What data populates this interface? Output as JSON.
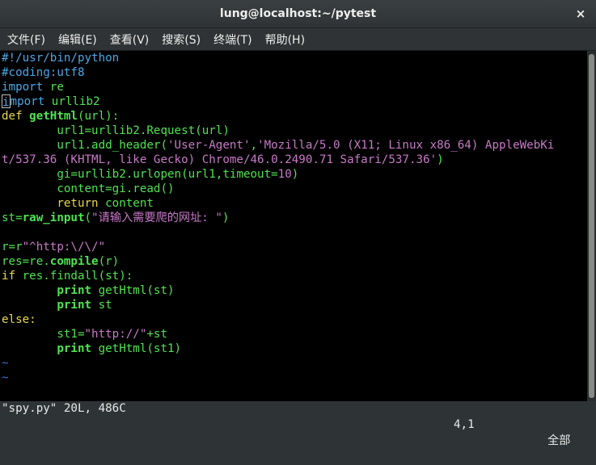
{
  "window": {
    "title": "lung@localhost:~/pytest",
    "close_glyph": "×"
  },
  "menu": [
    "文件(F)",
    "编辑(E)",
    "查看(V)",
    "搜索(S)",
    "终端(T)",
    "帮助(H)"
  ],
  "code": {
    "l1": "#!/usr/bin/python",
    "l2": "#coding:utf8",
    "l3a": "import",
    "l3b": " re",
    "l4_cursor": "i",
    "l4a": "mport",
    "l4b": " urllib2",
    "l5a": "def ",
    "l5b": "getHtml",
    "l5c": "(url):",
    "l6": "        url1=urllib2.Request(url)",
    "l7a": "        url1.add_header(",
    "l7b": "'User-Agent'",
    "l7c": ",",
    "l7d": "'Mozilla/5.0 (X11; Linux x86_64) AppleWebKi",
    "l8a": "t/537.36 (KHTML, like Gecko) Chrome/46.0.2490.71 Safari/537.36'",
    "l8b": ")",
    "l9a": "        gi=urllib2.urlopen(url1,timeout=",
    "l9b": "10",
    "l9c": ")",
    "l10": "        content=gi.read()",
    "l11a": "        ",
    "l11b": "return",
    "l11c": " content",
    "l12a": "st=",
    "l12b": "raw_input",
    "l12c": "(",
    "l12d": "\"请输入需要爬的网址: \"",
    "l12e": ")",
    "l14a": "r=r",
    "l14b": "\"^http:\\/\\/\"",
    "l15a": "res=re.",
    "l15b": "compile",
    "l15c": "(r)",
    "l16a": "if",
    "l16b": " res.findall(st):",
    "l17a": "        ",
    "l17b": "print",
    "l17c": " getHtml(st)",
    "l18a": "        ",
    "l18b": "print",
    "l18c": " st",
    "l19": "else:",
    "l20a": "        st1=",
    "l20b": "\"http://\"",
    "l20c": "+st",
    "l21a": "        ",
    "l21b": "print",
    "l21c": " getHtml(st1)",
    "tilde": "~"
  },
  "status": {
    "file": "\"spy.py\" 20L, 486C",
    "position": "4,1",
    "scroll": "全部"
  }
}
